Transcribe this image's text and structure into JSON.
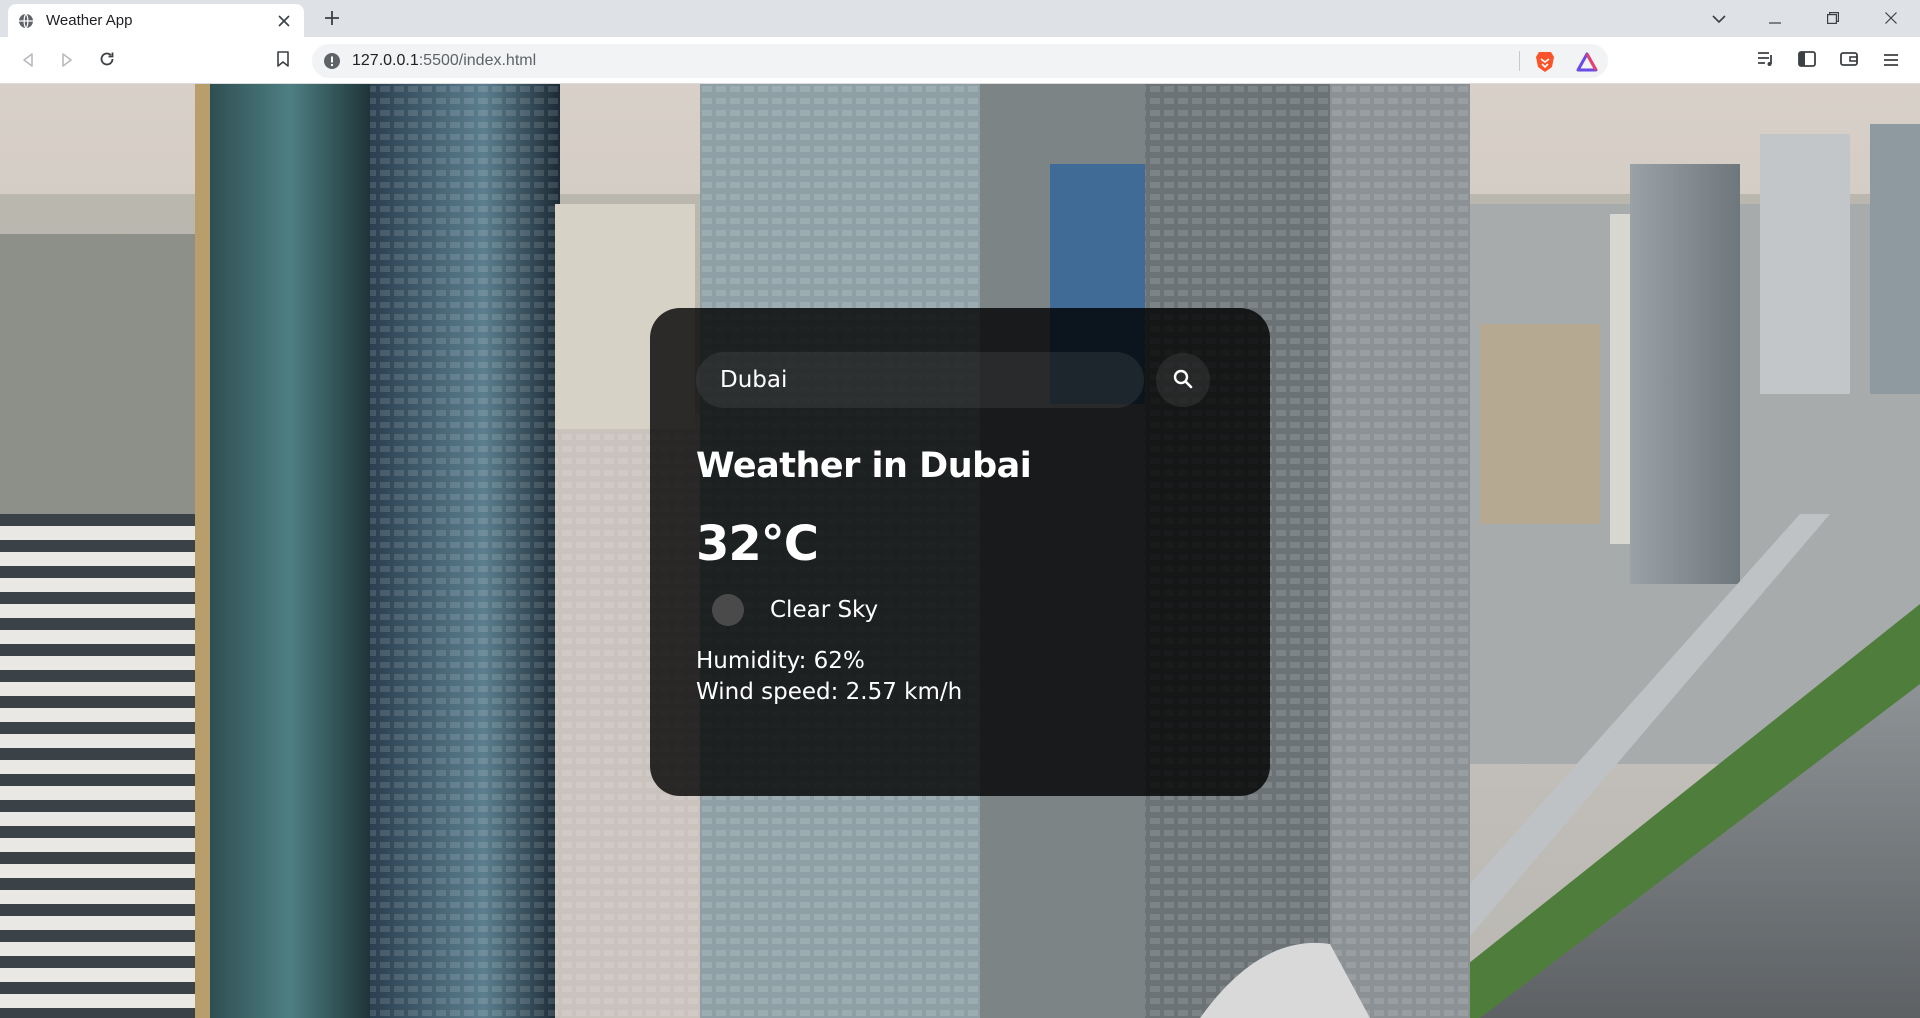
{
  "browser": {
    "tab_title": "Weather App",
    "url_host": "127.0.0.1",
    "url_path": ":5500/index.html"
  },
  "weather": {
    "search_value": "Dubai",
    "city_heading": "Weather in Dubai",
    "temperature": "32°C",
    "description": "Clear Sky",
    "humidity": "Humidity: 62%",
    "wind": "Wind speed: 2.57 km/h"
  },
  "icons": {
    "tab_favicon": "globe-icon",
    "tab_close": "close-icon",
    "new_tab": "plus-icon",
    "tab_search": "chevron-down-icon",
    "minimize": "minimize-icon",
    "maximize": "restore-icon",
    "close_window": "close-icon",
    "back": "arrow-left-icon",
    "forward": "arrow-right-icon",
    "reload": "reload-icon",
    "bookmark": "bookmark-icon",
    "site_info": "info-icon",
    "brave_shields": "lion-icon",
    "rewards": "triangle-icon",
    "media": "playlist-icon",
    "sidebar": "sidebar-icon",
    "wallet": "wallet-icon",
    "menu": "hamburger-icon",
    "search": "search-icon",
    "weather": "weather-icon"
  },
  "colors": {
    "card_bg": "#000000cc",
    "text": "#ffffff",
    "chrome_bg": "#dee1e6",
    "brave_orange": "#fb542b"
  }
}
